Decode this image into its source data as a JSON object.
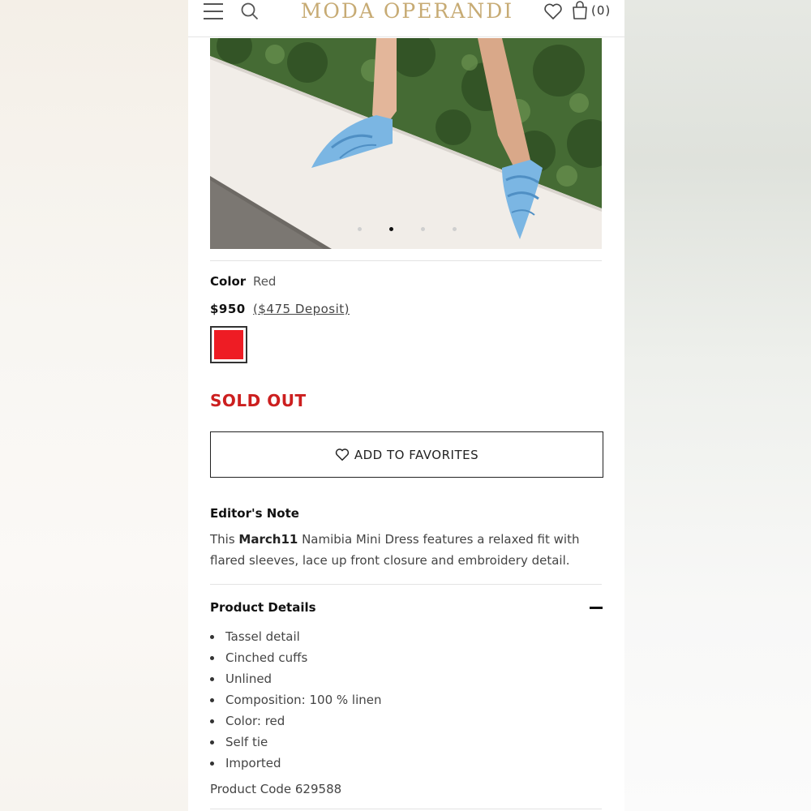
{
  "header": {
    "logo": "MODA OPERANDI",
    "bag_count": "(0)"
  },
  "gallery": {
    "slide_count": 4,
    "active_slide": 2
  },
  "product": {
    "color_label": "Color",
    "color_value": "Red",
    "price": "$950",
    "deposit": "($475 Deposit)",
    "swatch_color": "#ee1c24",
    "status": "SOLD OUT",
    "status_color": "#cc1f1f"
  },
  "actions": {
    "favorites_label": "ADD TO FAVORITES"
  },
  "editors_note": {
    "title": "Editor's Note",
    "prefix": "This ",
    "brand": "March11",
    "text": " Namibia Mini Dress features a relaxed fit with flared sleeves, lace up front closure and embroidery detail."
  },
  "product_details": {
    "title": "Product Details",
    "items": [
      "Tassel detail",
      "Cinched cuffs",
      "Unlined",
      "Composition: 100 % linen",
      "Color: red",
      "Self tie",
      "Imported"
    ],
    "code": "Product Code 629588"
  },
  "colors": {
    "brand_gold": "#c7ab74",
    "text_dark": "#222222"
  }
}
